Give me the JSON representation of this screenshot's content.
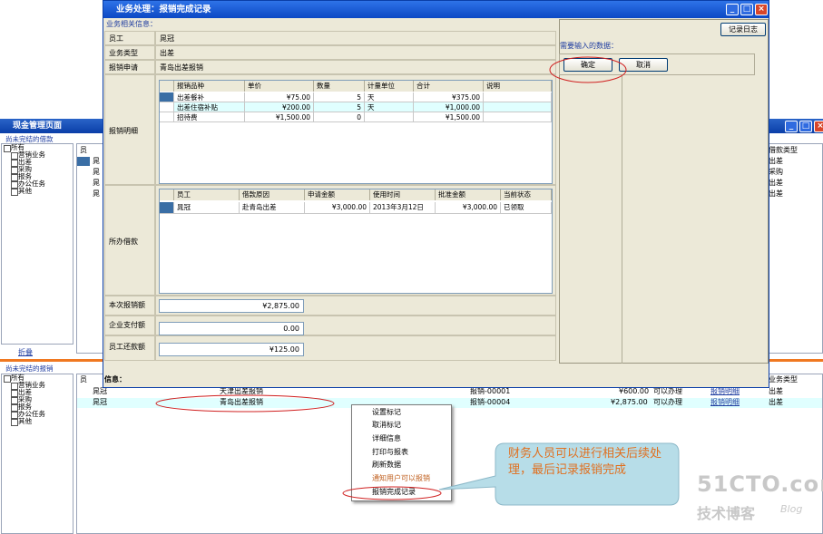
{
  "background_window": {
    "title": "现金管理页面",
    "section1_label": "尚未完结的借款",
    "section2_label": "尚未完结的报销",
    "collapse_link": "折叠",
    "tree_items": [
      "所有",
      "营销业务",
      "出差",
      "采购",
      "报务",
      "办公任务",
      "其他"
    ],
    "col_header_short": "员",
    "col_header_type": "借款类型",
    "top_rows": [
      {
        "emp": "晁",
        "type": "出差"
      },
      {
        "emp": "晁",
        "type": "采购"
      },
      {
        "emp": "晁",
        "type": "出差"
      },
      {
        "emp": "晁",
        "type": "出差"
      }
    ],
    "info_label": "信息：",
    "bottom_header_type": "业务类型",
    "bottom_rows": [
      {
        "emp": "晁冠",
        "desc": "天津出差报销",
        "code": "报销-00001",
        "amount": "¥600.00",
        "status": "可以办理",
        "link": "报销明细",
        "type": "出差"
      },
      {
        "emp": "晁冠",
        "desc": "青岛出差报销",
        "code": "报销-00004",
        "amount": "¥2,875.00",
        "status": "可以办理",
        "link": "报销明细",
        "type": "出差"
      }
    ]
  },
  "dialog": {
    "title": "业务处理：报销完成记录",
    "section_label": "业务相关信息：",
    "fields": [
      {
        "label": "员工",
        "value": "晁冠"
      },
      {
        "label": "业务类型",
        "value": "出差"
      },
      {
        "label": "报销申请",
        "value": "青岛出差报销"
      }
    ],
    "detail_label": "报销明细",
    "detail_headers": [
      "报销品种",
      "单价",
      "数量",
      "计量单位",
      "合计",
      "说明"
    ],
    "detail_rows": [
      {
        "item": "出差餐补",
        "price": "¥75.00",
        "qty": "5",
        "unit": "天",
        "total": "¥375.00",
        "note": ""
      },
      {
        "item": "出差住宿补贴",
        "price": "¥200.00",
        "qty": "5",
        "unit": "天",
        "total": "¥1,000.00",
        "note": ""
      },
      {
        "item": "招待费",
        "price": "¥1,500.00",
        "qty": "0",
        "unit": "",
        "total": "¥1,500.00",
        "note": ""
      }
    ],
    "loan_label": "所办借款",
    "loan_headers": [
      "员工",
      "借款原因",
      "申请金额",
      "使用时间",
      "批准金额",
      "当前状态"
    ],
    "loan_rows": [
      {
        "emp": "晁冠",
        "reason": "赴青岛出差",
        "amount": "¥3,000.00",
        "date": "2013年3月12日",
        "approved": "¥3,000.00",
        "status": "已领取"
      }
    ],
    "sum_fields": [
      {
        "label": "本次报销额",
        "value": "¥2,875.00"
      },
      {
        "label": "企业支付额",
        "value": "0.00"
      },
      {
        "label": "员工还款额",
        "value": "¥125.00"
      }
    ],
    "log_button": "记录日志",
    "input_label": "需要输入的数据：",
    "ok_button": "确定",
    "cancel_button": "取消"
  },
  "context_menu": {
    "items": [
      "设置标记",
      "取消标记",
      "详细信息",
      "打印与报表",
      "刷新数据",
      "通知用户可以报销",
      "报销完成记录"
    ]
  },
  "callout_text": "财务人员可以进行相关后续处理，最后记录报销完成",
  "watermark": {
    "brand": "51CTO.com",
    "sub": "技术博客",
    "blog": "Blog"
  },
  "colors": {
    "title_bar": "#0b48c4",
    "highlight_row": "#e0ffff",
    "annotation": "#d02020",
    "callout": "#b7dde8",
    "callout_text": "#e07020"
  }
}
